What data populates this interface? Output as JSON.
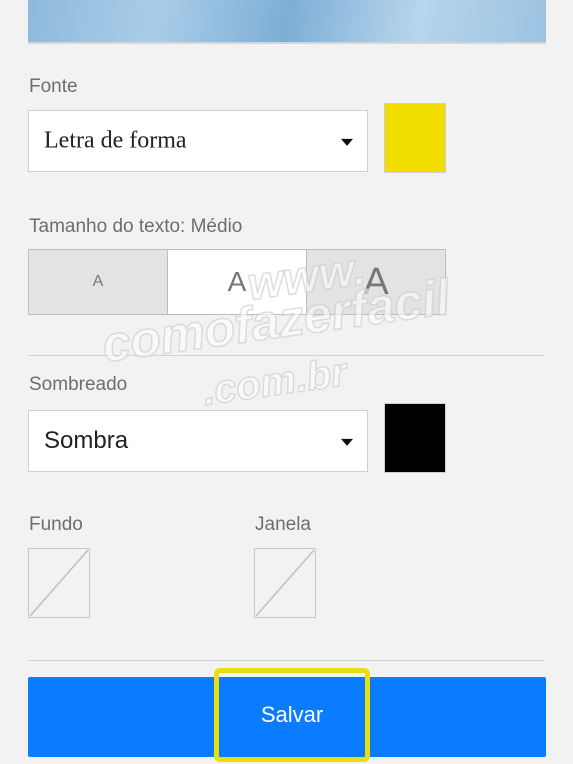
{
  "font_section": {
    "label": "Fonte",
    "select_value": "Letra de forma",
    "color": "#f2dd00"
  },
  "text_size": {
    "label": "Tamanho do texto: Médio",
    "options": [
      "A",
      "A",
      "A"
    ],
    "selected_index": 1
  },
  "shadow_section": {
    "label": "Sombreado",
    "select_value": "Sombra",
    "color": "#000000"
  },
  "background": {
    "label": "Fundo"
  },
  "window": {
    "label": "Janela"
  },
  "save_label": "Salvar",
  "watermark": {
    "line1": "www.",
    "line2": "comofazerfacil",
    "line3": ".com.br"
  }
}
